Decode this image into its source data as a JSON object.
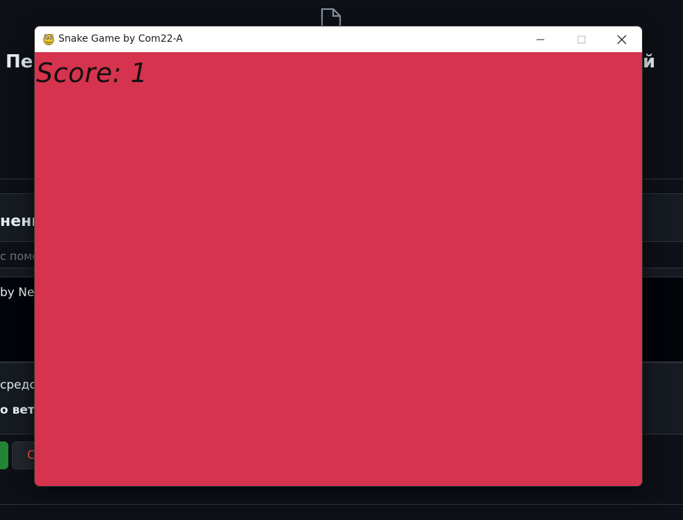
{
  "background": {
    "title_left": "Пер",
    "title_right": "й",
    "section_heading": "нени",
    "input_placeholder": "с помо",
    "textarea_text": "by Neth",
    "option_1_text": "средст",
    "option_2_text": "о ветк",
    "cancel_button_label": "С"
  },
  "window": {
    "title": "Snake Game by Com22-A",
    "minimize_icon": "minimize-icon",
    "maximize_icon": "maximize-icon",
    "close_icon": "close-icon"
  },
  "game": {
    "score_text": "Score: 1",
    "background_color": "#d6334e"
  }
}
